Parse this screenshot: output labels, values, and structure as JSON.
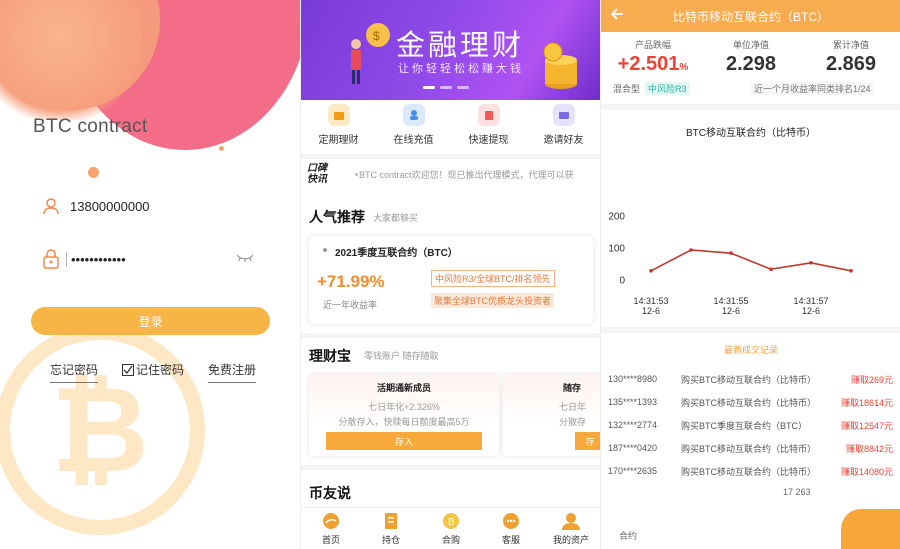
{
  "login": {
    "title": "BTC contract",
    "phone": "13800000000",
    "password_masked": "••••••••••••",
    "login_button": "登录",
    "forgot": "忘记密码",
    "remember": "记住密码",
    "register": "免费注册",
    "colors": {
      "accent": "#f7b545",
      "blob": "#f36c88"
    }
  },
  "home": {
    "banner_title": "金融理财",
    "banner_sub": "让你轻轻松松赚大钱",
    "quick": [
      {
        "label": "定期理财",
        "icon": "wallet-icon",
        "color": "#f7b545"
      },
      {
        "label": "在线充值",
        "icon": "recharge-icon",
        "color": "#4a90e2"
      },
      {
        "label": "快速提现",
        "icon": "withdraw-icon",
        "color": "#f05a5a"
      },
      {
        "label": "邀请好友",
        "icon": "invite-icon",
        "color": "#7a6ce0"
      }
    ],
    "notice_badge_1": "口碑",
    "notice_badge_2": "快讯",
    "notice_text": "BTC contract欢迎您！现已推出代理模式，代理可以获",
    "popular_title": "人气推荐",
    "popular_sub": "大家都够买",
    "card": {
      "name": "2021季度互联合约（BTC）",
      "rate": "+71.99%",
      "rate_label": "近一年收益率",
      "tag1": "中风险R3/全球BTC/排名领先",
      "tag2": "聚集全球BTC优质龙头投资者"
    },
    "licai_title": "理财宝",
    "licai_sub": "零钱账户 随存随取",
    "licai_cards": [
      {
        "title": "活期通新成员",
        "line1": "七日年化+2.326%",
        "line2": "分散存入，快赎每日额度最高5万",
        "button": "存入"
      },
      {
        "title": "随存",
        "line1": "七日年",
        "line2": "分散存",
        "button": "存"
      }
    ],
    "friends_title": "币友说",
    "tabs": [
      {
        "label": "首页",
        "icon": "home-icon"
      },
      {
        "label": "持仓",
        "icon": "holdings-icon"
      },
      {
        "label": "合购",
        "icon": "coin-icon"
      },
      {
        "label": "客服",
        "icon": "service-icon"
      },
      {
        "label": "我的资产",
        "icon": "user-icon"
      }
    ]
  },
  "detail": {
    "header": "比特币移动互联合约（BTC）",
    "stat1_label": "产品跌幅",
    "stat1_value": "+2.501",
    "stat1_unit": "%",
    "stat2_label": "单位净值",
    "stat2_value": "2.298",
    "stat3_label": "累计净值",
    "stat3_value": "2.869",
    "tag_type": "混合型",
    "tag_risk": "中风险R3",
    "tag_rank": "近一个月收益率同类排名1/24",
    "chart_title": "BTC移动互联合约（比特币）",
    "recent_title": "最新成交记录",
    "records": [
      {
        "phone": "130****8980",
        "desc": "购买BTC移动互联合约（比特币）",
        "amount": "赚取269元"
      },
      {
        "phone": "135****1393",
        "desc": "购买BTC移动互联合约（比特币）",
        "amount": "赚取18614元"
      },
      {
        "phone": "132****2774",
        "desc": "购买BTC季度互联合约（BTC）",
        "amount": "赚取12547元"
      },
      {
        "phone": "187****0420",
        "desc": "购买BTC移动互联合约（比特币）",
        "amount": "赚取8842元"
      },
      {
        "phone": "170****2635",
        "desc": "购买BTC移动互联合约（比特币）",
        "amount": "赚取14080元"
      }
    ],
    "footer_partial": "17 263",
    "footer_label": "合约"
  },
  "chart_data": {
    "type": "line",
    "title": "BTC移动互联合约（比特币）",
    "x": [
      "14:31:53 12-6",
      "",
      "14:31:55 12-6",
      "",
      "14:31:57 12-6",
      ""
    ],
    "x_ticks": [
      {
        "time": "14:31:53",
        "date": "12-6"
      },
      {
        "time": "14:31:55",
        "date": "12-6"
      },
      {
        "time": "14:31:57",
        "date": "12-6"
      }
    ],
    "yticks": [
      0,
      100,
      200
    ],
    "ylim": [
      -30,
      220
    ],
    "series": [
      {
        "values": [
          30,
          95,
          85,
          35,
          55,
          30
        ]
      }
    ],
    "color": "#c0392b"
  }
}
